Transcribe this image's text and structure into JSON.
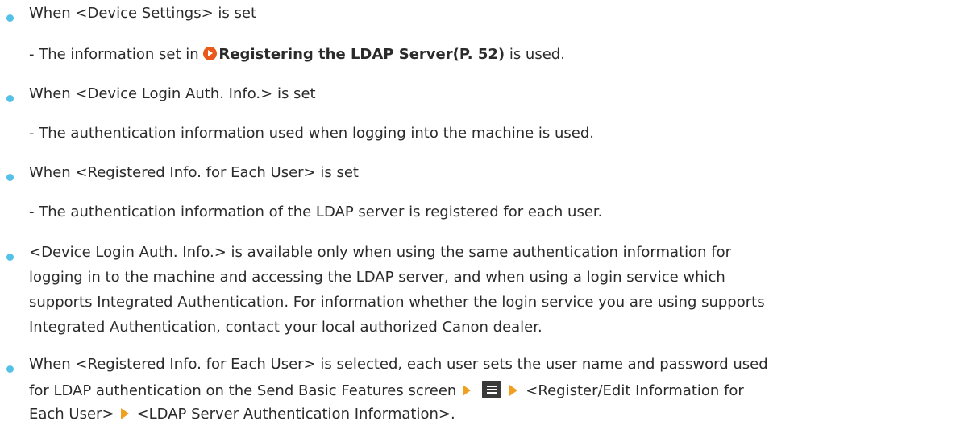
{
  "items": [
    {
      "bullet_text": "When <Device Settings> is set",
      "sub_prefix": "- The information set in ",
      "link_text": "Registering the LDAP Server(P. 52)",
      "sub_suffix": " is used."
    },
    {
      "bullet_text": "When <Device Login Auth. Info.> is set",
      "sub_text": "- The authentication information used when logging into the machine is used."
    },
    {
      "bullet_text": "When <Registered Info. for Each User> is set",
      "sub_text": "- The authentication information of the LDAP server is registered for each user."
    }
  ],
  "note1": {
    "lines": [
      "<Device Login Auth. Info.> is available only when using the same authentication information for",
      "logging in to the machine and accessing the LDAP server, and when using a login service which",
      "supports Integrated Authentication. For information whether the login service you are using supports",
      "Integrated Authentication, contact your local authorized Canon dealer."
    ]
  },
  "note2": {
    "line1": "When <Registered Info. for Each User> is selected, each user sets the user name and password used",
    "line2_prefix": "for LDAP authentication on the Send Basic Features screen",
    "line2_suffix": "<Register/Edit Information for",
    "line3_prefix": "Each User>",
    "line3_suffix": "<LDAP Server Authentication Information>."
  },
  "icons": {
    "bullet_color": "#55c1e9",
    "link_icon": "link-arrow-icon",
    "step_arrow": "step-arrow-icon",
    "menu_icon": "menu-icon"
  }
}
